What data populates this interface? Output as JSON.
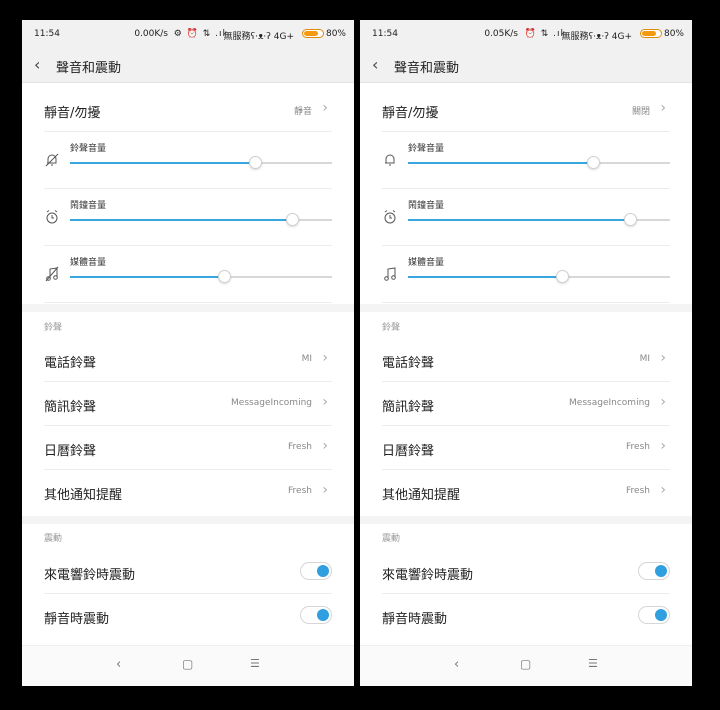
{
  "screens": [
    {
      "status": {
        "time": "11:54",
        "net": "0.00K/s",
        "icons": "⚙ ⏰ ⇅ .ıl",
        "carrier": "無服務ʕ·ᴥ·ʔ 4G+",
        "battery_level": 0.8,
        "battery_pct": "80%"
      },
      "header": {
        "title": "聲音和震動"
      },
      "silent": {
        "label": "靜音/勿擾",
        "value": "靜音"
      },
      "volumes": [
        {
          "label": "鈴聲音量",
          "icon": "bell-off-icon",
          "level": 0.71
        },
        {
          "label": "鬧鐘音量",
          "icon": "alarm-clock-icon",
          "level": 0.85
        },
        {
          "label": "媒體音量",
          "icon": "music-off-icon",
          "level": 0.59
        }
      ],
      "ringtone_section": "鈴聲",
      "ringtones": [
        {
          "label": "電話鈴聲",
          "value": "MI"
        },
        {
          "label": "簡訊鈴聲",
          "value": "MessageIncoming"
        },
        {
          "label": "日曆鈴聲",
          "value": "Fresh"
        },
        {
          "label": "其他通知提醒",
          "value": "Fresh"
        }
      ],
      "vibrate_section": "震動",
      "vibrations": [
        {
          "label": "來電響鈴時震動",
          "on": true
        },
        {
          "label": "靜音時震動",
          "on": true
        }
      ]
    },
    {
      "status": {
        "time": "11:54",
        "net": "0.05K/s",
        "icons": "⏰ ⇅ .ıl",
        "carrier": "無服務ʕ·ᴥ·ʔ 4G+",
        "battery_level": 0.8,
        "battery_pct": "80%"
      },
      "header": {
        "title": "聲音和震動"
      },
      "silent": {
        "label": "靜音/勿擾",
        "value": "關閉"
      },
      "volumes": [
        {
          "label": "鈴聲音量",
          "icon": "bell-icon",
          "level": 0.71
        },
        {
          "label": "鬧鐘音量",
          "icon": "alarm-clock-icon",
          "level": 0.85
        },
        {
          "label": "媒體音量",
          "icon": "music-note-icon",
          "level": 0.59
        }
      ],
      "ringtone_section": "鈴聲",
      "ringtones": [
        {
          "label": "電話鈴聲",
          "value": "MI"
        },
        {
          "label": "簡訊鈴聲",
          "value": "MessageIncoming"
        },
        {
          "label": "日曆鈴聲",
          "value": "Fresh"
        },
        {
          "label": "其他通知提醒",
          "value": "Fresh"
        }
      ],
      "vibrate_section": "震動",
      "vibrations": [
        {
          "label": "來電響鈴時震動",
          "on": true
        },
        {
          "label": "靜音時震動",
          "on": true
        }
      ]
    }
  ],
  "colors": {
    "accent": "#3aa6df",
    "battery": "#f39a10"
  },
  "nav": {
    "back": "‹",
    "home": "▢",
    "menu": "☰"
  }
}
